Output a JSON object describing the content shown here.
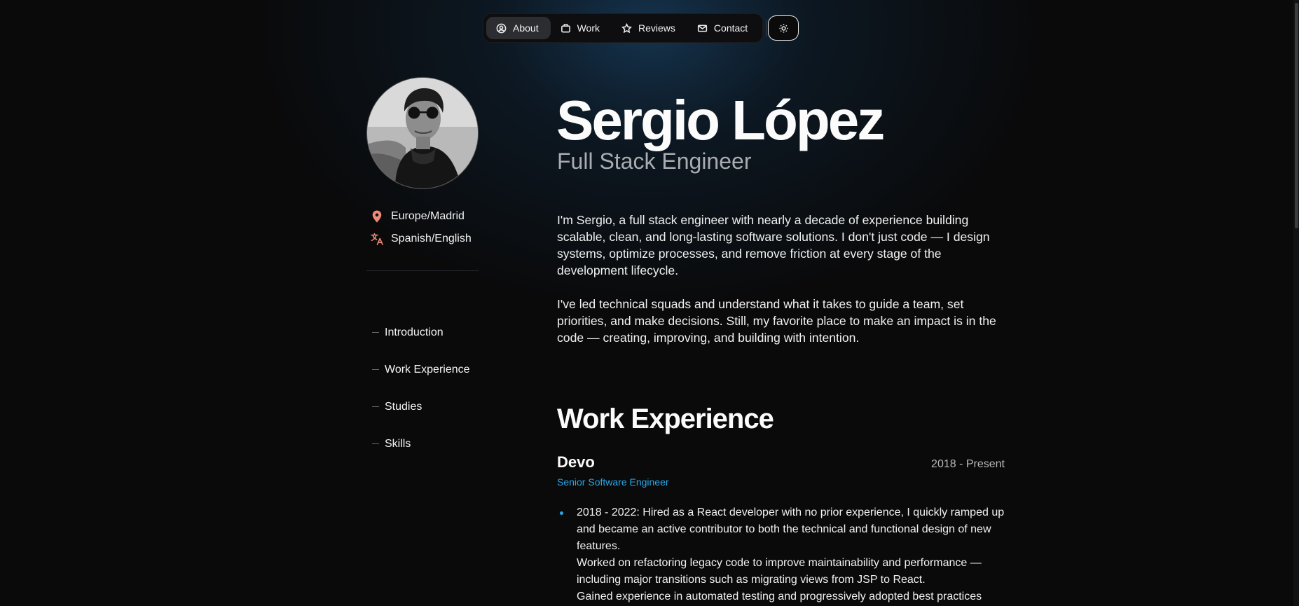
{
  "nav": {
    "items": [
      {
        "label": "About",
        "icon": "user-circle-icon",
        "active": true
      },
      {
        "label": "Work",
        "icon": "briefcase-icon",
        "active": false
      },
      {
        "label": "Reviews",
        "icon": "star-icon",
        "active": false
      },
      {
        "label": "Contact",
        "icon": "mail-icon",
        "active": false
      }
    ],
    "theme_toggle_icon": "sun-icon"
  },
  "profile": {
    "location": "Europe/Madrid",
    "languages": "Spanish/English",
    "accent_color": "#f08a76"
  },
  "toc": {
    "items": [
      "Introduction",
      "Work Experience",
      "Studies",
      "Skills"
    ]
  },
  "hero": {
    "name": "Sergio López",
    "role": "Full Stack Engineer"
  },
  "intro": {
    "paragraphs": [
      "I'm Sergio, a full stack engineer with nearly a decade of experience building scalable, clean, and long-lasting software solutions. I don't just code — I design systems, optimize processes, and remove friction at every stage of the development lifecycle.",
      "I've led technical squads and understand what it takes to guide a team, set priorities, and make decisions. Still, my favorite place to make an impact is in the code — creating, improving, and building with intention."
    ]
  },
  "work": {
    "title": "Work Experience",
    "jobs": [
      {
        "company": "Devo",
        "period": "2018 - Present",
        "position": "Senior Software Engineer",
        "bullet_lines": [
          "2018 - 2022: Hired as a React developer with no prior experience, I quickly ramped up and became an active contributor to both the technical and functional design of new features.",
          "Worked on refactoring legacy code to improve maintainability and performance — including major transitions such as migrating views from JSP to React.",
          "Gained experience in automated testing and progressively adopted best practices"
        ]
      }
    ]
  },
  "colors": {
    "link_accent": "#2ba7e6",
    "background": "#0a0a0b"
  }
}
